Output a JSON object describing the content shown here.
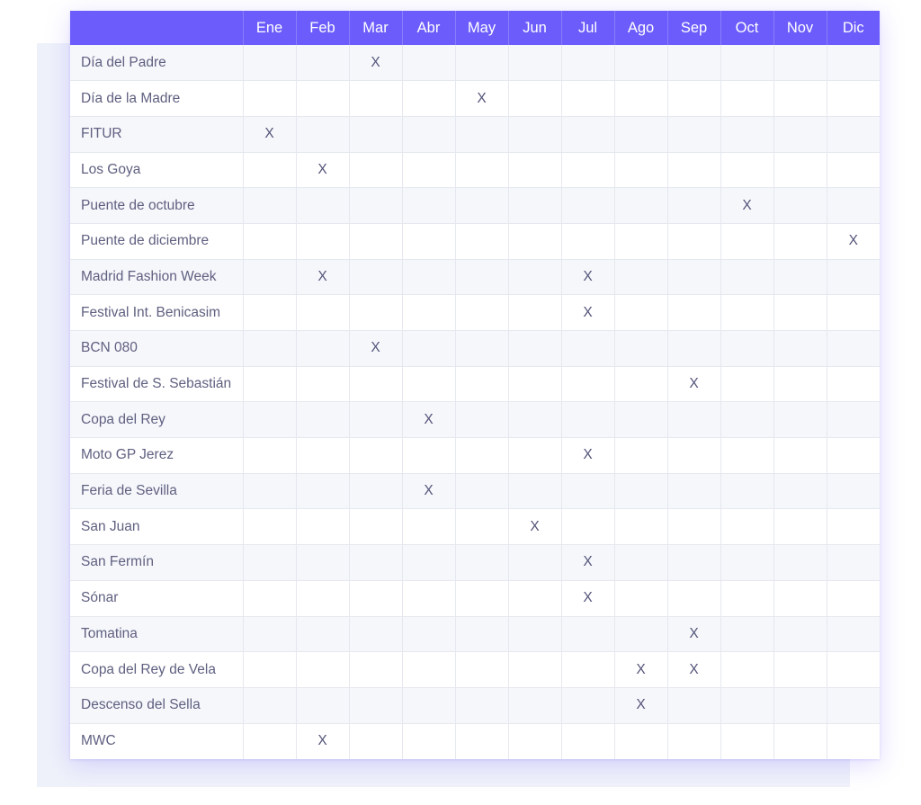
{
  "colors": {
    "header_bg": "#6C5CFB",
    "header_text": "#FFFFFF",
    "row_text": "#5F6080",
    "row_alt_bg": "#F6F7FB",
    "row_bg": "#FFFFFF",
    "grid_line": "#E6E8EF",
    "backdrop": "#EFF1FA",
    "mark_text": "#54557A"
  },
  "table": {
    "corner_header": "",
    "columns": [
      "Ene",
      "Feb",
      "Mar",
      "Abr",
      "May",
      "Jun",
      "Jul",
      "Ago",
      "Sep",
      "Oct",
      "Nov",
      "Dic"
    ],
    "mark": "X",
    "rows": [
      {
        "label": "Día del Padre",
        "marks": [
          "",
          "",
          "X",
          "",
          "",
          "",
          "",
          "",
          "",
          "",
          "",
          ""
        ]
      },
      {
        "label": "Día de la Madre",
        "marks": [
          "",
          "",
          "",
          "",
          "X",
          "",
          "",
          "",
          "",
          "",
          "",
          ""
        ]
      },
      {
        "label": "FITUR",
        "marks": [
          "X",
          "",
          "",
          "",
          "",
          "",
          "",
          "",
          "",
          "",
          "",
          ""
        ]
      },
      {
        "label": "Los Goya",
        "marks": [
          "",
          "X",
          "",
          "",
          "",
          "",
          "",
          "",
          "",
          "",
          "",
          ""
        ]
      },
      {
        "label": "Puente de octubre",
        "marks": [
          "",
          "",
          "",
          "",
          "",
          "",
          "",
          "",
          "",
          "X",
          "",
          ""
        ]
      },
      {
        "label": "Puente de diciembre",
        "marks": [
          "",
          "",
          "",
          "",
          "",
          "",
          "",
          "",
          "",
          "",
          "",
          "X"
        ]
      },
      {
        "label": "Madrid Fashion Week",
        "marks": [
          "",
          "X",
          "",
          "",
          "",
          "",
          "X",
          "",
          "",
          "",
          "",
          ""
        ]
      },
      {
        "label": "Festival Int. Benicasim",
        "marks": [
          "",
          "",
          "",
          "",
          "",
          "",
          "X",
          "",
          "",
          "",
          "",
          ""
        ]
      },
      {
        "label": "BCN 080",
        "marks": [
          "",
          "",
          "X",
          "",
          "",
          "",
          "",
          "",
          "",
          "",
          "",
          ""
        ]
      },
      {
        "label": "Festival de S. Sebastián",
        "marks": [
          "",
          "",
          "",
          "",
          "",
          "",
          "",
          "",
          "X",
          "",
          "",
          ""
        ]
      },
      {
        "label": "Copa del Rey",
        "marks": [
          "",
          "",
          "",
          "X",
          "",
          "",
          "",
          "",
          "",
          "",
          "",
          ""
        ]
      },
      {
        "label": "Moto GP Jerez",
        "marks": [
          "",
          "",
          "",
          "",
          "",
          "",
          "X",
          "",
          "",
          "",
          "",
          ""
        ]
      },
      {
        "label": "Feria de Sevilla",
        "marks": [
          "",
          "",
          "",
          "X",
          "",
          "",
          "",
          "",
          "",
          "",
          "",
          ""
        ]
      },
      {
        "label": "San Juan",
        "marks": [
          "",
          "",
          "",
          "",
          "",
          "X",
          "",
          "",
          "",
          "",
          "",
          ""
        ]
      },
      {
        "label": "San Fermín",
        "marks": [
          "",
          "",
          "",
          "",
          "",
          "",
          "X",
          "",
          "",
          "",
          "",
          ""
        ]
      },
      {
        "label": "Sónar",
        "marks": [
          "",
          "",
          "",
          "",
          "",
          "",
          "X",
          "",
          "",
          "",
          "",
          ""
        ]
      },
      {
        "label": "Tomatina",
        "marks": [
          "",
          "",
          "",
          "",
          "",
          "",
          "",
          "",
          "X",
          "",
          "",
          ""
        ]
      },
      {
        "label": "Copa del Rey de Vela",
        "marks": [
          "",
          "",
          "",
          "",
          "",
          "",
          "",
          "X",
          "X",
          "",
          "",
          ""
        ]
      },
      {
        "label": "Descenso del Sella",
        "marks": [
          "",
          "",
          "",
          "",
          "",
          "",
          "",
          "X",
          "",
          "",
          "",
          ""
        ]
      },
      {
        "label": "MWC",
        "marks": [
          "",
          "X",
          "",
          "",
          "",
          "",
          "",
          "",
          "",
          "",
          "",
          ""
        ]
      }
    ]
  }
}
